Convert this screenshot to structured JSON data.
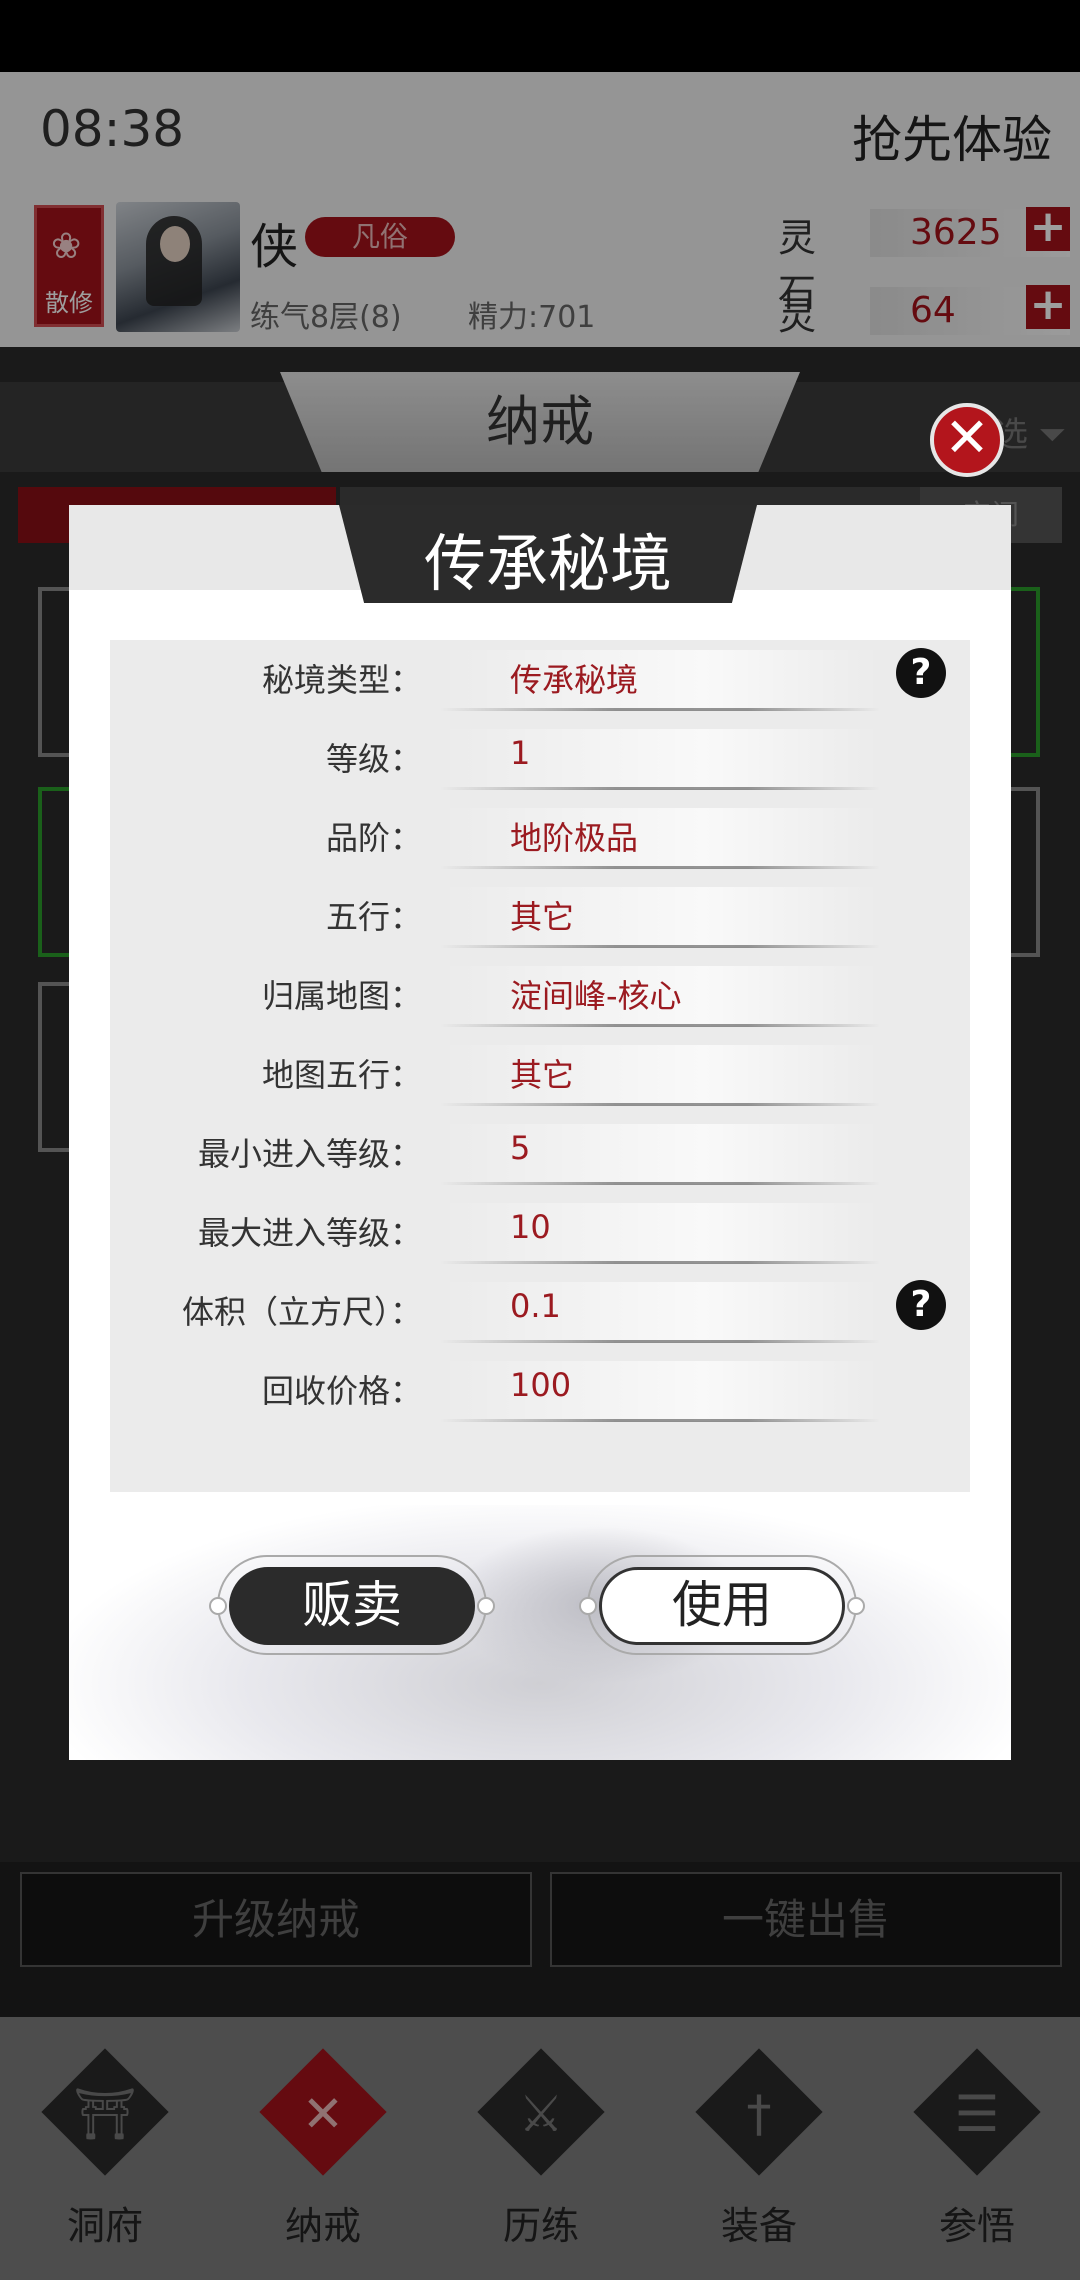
{
  "status": {
    "clock": "08:38",
    "early_access": "抢先体验"
  },
  "player": {
    "sect_label": "散修",
    "name": "侠",
    "rank": "凡俗",
    "cultivation": "练气8层(8)",
    "energy": "精力:701"
  },
  "resources": [
    {
      "label": "灵石",
      "value": "3625"
    },
    {
      "label": "灵玉",
      "value": "64"
    }
  ],
  "bag": {
    "title": "纳戒",
    "filter_label": "选",
    "space_label": "空间",
    "upgrade_button": "升级纳戒",
    "sell_all_button": "一键出售"
  },
  "nav": [
    {
      "label": "洞府",
      "icon": "cave-dwelling-icon",
      "glyph": "⛩"
    },
    {
      "label": "纳戒",
      "icon": "ring-icon",
      "glyph": "✕"
    },
    {
      "label": "历练",
      "icon": "crossed-swords-icon",
      "glyph": "⚔"
    },
    {
      "label": "装备",
      "icon": "sword-icon",
      "glyph": "†"
    },
    {
      "label": "参悟",
      "icon": "book-icon",
      "glyph": "☰"
    }
  ],
  "modal": {
    "title": "传承秘境",
    "rows": [
      {
        "key": "秘境类型：",
        "value": "传承秘境",
        "help": true
      },
      {
        "key": "等级：",
        "value": "1"
      },
      {
        "key": "品阶：",
        "value": "地阶极品"
      },
      {
        "key": "五行：",
        "value": "其它"
      },
      {
        "key": "归属地图：",
        "value": "淀间峰-核心"
      },
      {
        "key": "地图五行：",
        "value": "其它"
      },
      {
        "key": "最小进入等级：",
        "value": "5"
      },
      {
        "key": "最大进入等级：",
        "value": "10"
      },
      {
        "key": "体积（立方尺）：",
        "value": "0.1",
        "help": true
      },
      {
        "key": "回收价格：",
        "value": "100"
      }
    ],
    "sell_button": "贩卖",
    "use_button": "使用",
    "help_glyph": "?",
    "close_glyph": "✕"
  },
  "colors": {
    "accent_red": "#a3131a",
    "value_red": "#9b1a20",
    "dark": "#2b2b2b"
  }
}
